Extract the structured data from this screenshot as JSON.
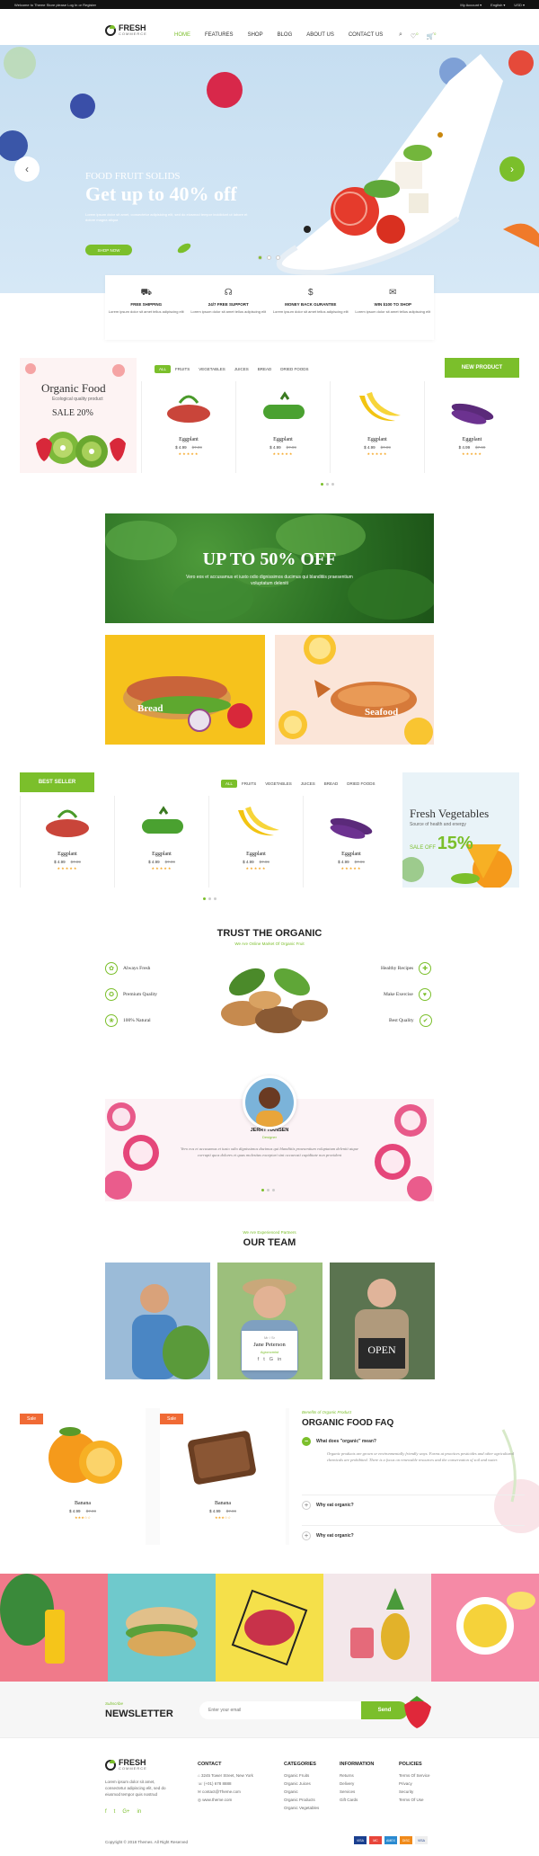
{
  "topbar": {
    "welcome": "Welcome to Theme Store please Log In or Register",
    "account": "My Account ▾",
    "language": "English ▾",
    "currency": "USD ▾"
  },
  "header": {
    "logo_main": "FRESH",
    "logo_sub": "COMMERCE",
    "nav": [
      "HOME",
      "FEATURES",
      "SHOP",
      "BLOG",
      "ABOUT US",
      "CONTACT US"
    ],
    "cart_count": "0",
    "wish_count": "0"
  },
  "hero": {
    "kicker": "FOOD FRUIT SOLIDS",
    "title": "Get up to 40% off",
    "desc": "Lorem ipsum dolor sit amet, consectetur adipisicing elit, sed do eiusmod tempor incididunt ut labore et dolore magna aliqua",
    "button": "SHOP NOW"
  },
  "features": [
    {
      "icon": "truck-icon",
      "title": "FREE SHIPPING",
      "text": "Lorem ipsum dolor sit amet tellus adipiscing elit"
    },
    {
      "icon": "headset-icon",
      "title": "24/7 FREE SUPPORT",
      "text": "Lorem ipsum dolor sit amet tellus adipiscing elit"
    },
    {
      "icon": "money-icon",
      "title": "MONEY BACK GURANTEE",
      "text": "Lorem ipsum dolor sit amet tellus adipiscing elit"
    },
    {
      "icon": "gift-icon",
      "title": "WIN $100 TO SHOP",
      "text": "Lorem ipsum dolor sit amet tellus adipiscing elit"
    }
  ],
  "organic_promo": {
    "title": "Organic Food",
    "subtitle": "Ecological quality product",
    "sale": "SALE 20%"
  },
  "product_tabs": [
    "ALL",
    "FRUITS",
    "VEGETABLES",
    "JUICES",
    "BREAD",
    "DRIED FOODS"
  ],
  "new_product_label": "NEW PRODUCT",
  "best_seller_label": "BEST SELLER",
  "products_row1": [
    {
      "name": "Eggplant",
      "price": "$ 4.99",
      "old": "$7.99",
      "stars": "★★★★★"
    },
    {
      "name": "Eggplant",
      "price": "$ 4.99",
      "old": "$7.99",
      "stars": "★★★★★"
    },
    {
      "name": "Eggplant",
      "price": "$ 4.99",
      "old": "$7.99",
      "stars": "★★★★★"
    },
    {
      "name": "Eggplant",
      "price": "$ 4.99",
      "old": "$7.99",
      "stars": "★★★★★"
    }
  ],
  "products_row2": [
    {
      "name": "Eggplant",
      "price": "$ 4.99",
      "old": "$7.99",
      "stars": "★★★★★"
    },
    {
      "name": "Eggplant",
      "price": "$ 4.99",
      "old": "$7.99",
      "stars": "★★★★★"
    },
    {
      "name": "Eggplant",
      "price": "$ 4.99",
      "old": "$7.99",
      "stars": "★★★★★"
    },
    {
      "name": "Eggplant",
      "price": "$ 4.99",
      "old": "$7.99",
      "stars": "★★★★★"
    }
  ],
  "banner50": {
    "title": "UP TO 50% OFF",
    "desc": "Vero eos et accusamus et iusto odio dignissimos ducimus qui blanditiis praesentium voluptatum deleniti"
  },
  "tiles": {
    "bread": "Bread",
    "seafood": "Seafood"
  },
  "fresh_veg": {
    "title": "Fresh Vegetables",
    "subtitle": "Source of health and energy",
    "sale": "SALE OFF",
    "percent": "15%"
  },
  "trust": {
    "title": "TRUST THE ORGANIC",
    "subtitle": "We Are Online Market Of Organic Fruit",
    "left": [
      "Always Fresh",
      "Premium Quality",
      "100% Natural"
    ],
    "right": [
      "Healthy Recipes",
      "Make Exercise",
      "Best Quality"
    ]
  },
  "testimonial": {
    "name": "JERRY HANSEN",
    "role": "Designer",
    "quote": "Vero eos et accusamus et iusto odio dignissimos ducimus qui blanditiis praesentium voluptatum deleniti atque corrupti quos dolores et quas molestias excepturi sint occaecati cupiditate non provident"
  },
  "team": {
    "kicker": "We Are Experienced Partners",
    "title": "OUR TEAM",
    "role": "Mr / Sr",
    "member": "Jane Peterson",
    "member_role": "Agronomist",
    "sign": "OPEN"
  },
  "sale_products": [
    {
      "tag": "Sale",
      "name": "Banana",
      "price": "$ 4.99",
      "old": "$7.99",
      "stars": "★★★☆☆"
    },
    {
      "tag": "Sale",
      "name": "Banana",
      "price": "$ 4.99",
      "old": "$7.99",
      "stars": "★★★☆☆"
    }
  ],
  "faq": {
    "kicker": "Benefits of Organic Product",
    "title": "ORGANIC FOOD FAQ",
    "items": [
      {
        "q": "What does \"organic\" mean?",
        "a": "Organic products are grown or environmentally friendly ways. Farms at practices pesticides and other agricultural chemicals are prohibited. There is a focus on renewable resources and the conservation of soil and water."
      },
      {
        "q": "Why eat organic?",
        "a": ""
      },
      {
        "q": "Why eat organic?",
        "a": ""
      }
    ]
  },
  "newsletter": {
    "kicker": "Subscribe",
    "title": "NEWSLETTER",
    "placeholder": "Enter your email",
    "button": "Send"
  },
  "footer": {
    "logo_main": "FRESH",
    "logo_sub": "COMMERCE",
    "about": "Lorem ipsum dolor sit amet, consectetur adipiscing elit, sed do eiusmod tempor quis nostrud",
    "contact_title": "CONTACT",
    "contact": [
      "3245 Tower Street, New York",
      "(+01) 678 8888",
      "contact@Theme.com",
      "www.theme.com"
    ],
    "categories_title": "CATEGORIES",
    "categories": [
      "Organic Fruits",
      "Organic Juices",
      "Organic",
      "Organic Products",
      "Organic Vegetables"
    ],
    "information_title": "INFORMATION",
    "information": [
      "Returns",
      "Delivery",
      "Services",
      "Gift Cards"
    ],
    "policies_title": "POLICIES",
    "policies": [
      "Terms Of Service",
      "Privacy",
      "Security",
      "Terms Of Use"
    ],
    "copyright": "Copyright © 2018 Themes. All Right Reserved",
    "payments": [
      "VISA",
      "MC",
      "AMEX",
      "DISC",
      "VISA"
    ]
  }
}
